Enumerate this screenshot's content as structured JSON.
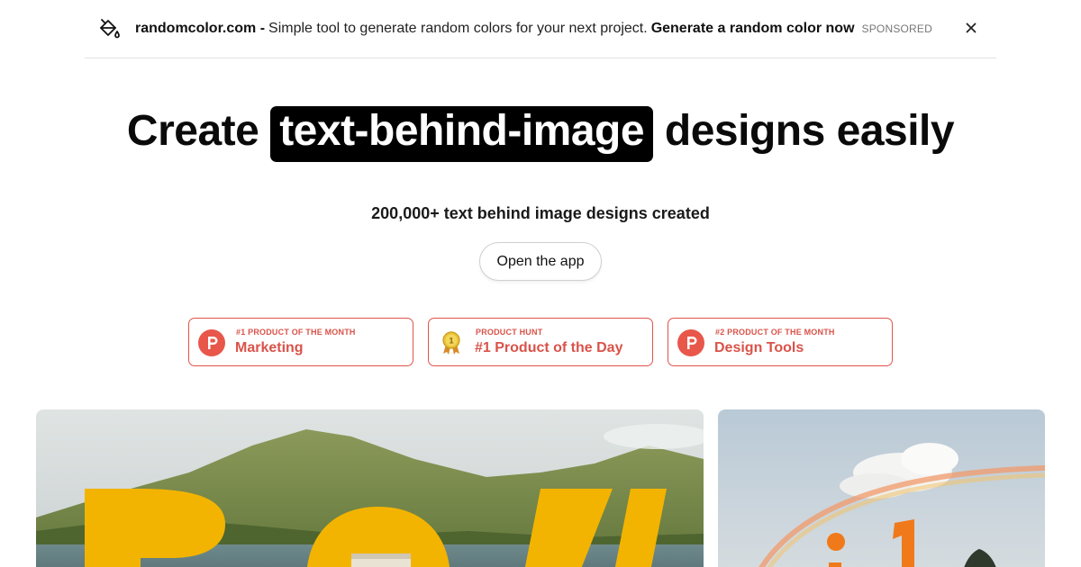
{
  "banner": {
    "icon": "paint-bucket-icon",
    "brand": "randomcolor.com -",
    "description": "Simple tool to generate random colors for your next project.",
    "cta": "Generate a random color now",
    "sponsored": "SPONSORED",
    "close_icon": "close-icon"
  },
  "hero": {
    "headline_pre": "Create",
    "headline_highlight": "text-behind-image",
    "headline_post": "designs easily",
    "stat": "200,000+ text behind image designs created",
    "open_app_label": "Open the app"
  },
  "badges": [
    {
      "icon": "producthunt-icon",
      "top": "#1 PRODUCT OF THE MONTH",
      "main": "Marketing"
    },
    {
      "icon": "medal-icon",
      "top": "PRODUCT HUNT",
      "main": "#1 Product of the Day"
    },
    {
      "icon": "producthunt-icon",
      "top": "#2 PRODUCT OF THE MONTH",
      "main": "Design Tools"
    }
  ],
  "colors": {
    "badge_accent": "#da552f",
    "overlay_text_yellow": "#f2b200",
    "overlay_text_orange": "#f07a1a"
  },
  "showcase": {
    "left_image": "mountain-lake-with-yellow-text",
    "right_image": "sky-rainbow-with-orange-text"
  }
}
